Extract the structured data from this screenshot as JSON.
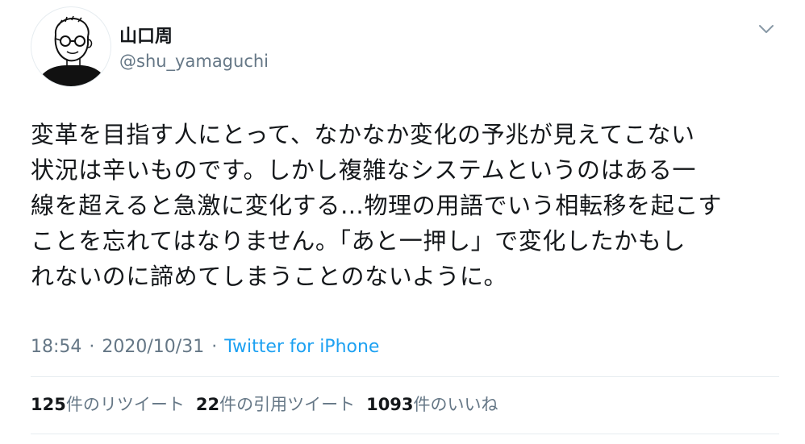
{
  "user": {
    "display_name": "山口周",
    "handle": "@shu_yamaguchi",
    "avatar_icon": "sketch-portrait-avatar"
  },
  "menu": {
    "icon": "chevron-down-icon"
  },
  "tweet": {
    "text": "変革を目指す人にとって、なかなか変化の予兆が見えてこない\n状況は辛いものです。しかし複雑なシステムというのはある一\n線を超えると急激に変化する…物理の用語でいう相転移を起こす\nことを忘れてはなりません。「あと一押し」で変化したかもし\nれないのに諦めてしまうことのないように。",
    "time": "18:54",
    "separator": "·",
    "date": "2020/10/31",
    "source": "Twitter for iPhone"
  },
  "stats": {
    "retweets_count": "125",
    "retweets_label": "件のリツイート",
    "quotes_count": "22",
    "quotes_label": "件の引用ツイート",
    "likes_count": "1093",
    "likes_label": "件のいいね"
  },
  "colors": {
    "text": "#14171a",
    "secondary": "#657786",
    "link": "#1da1f2",
    "divider": "#e6ecf0"
  }
}
